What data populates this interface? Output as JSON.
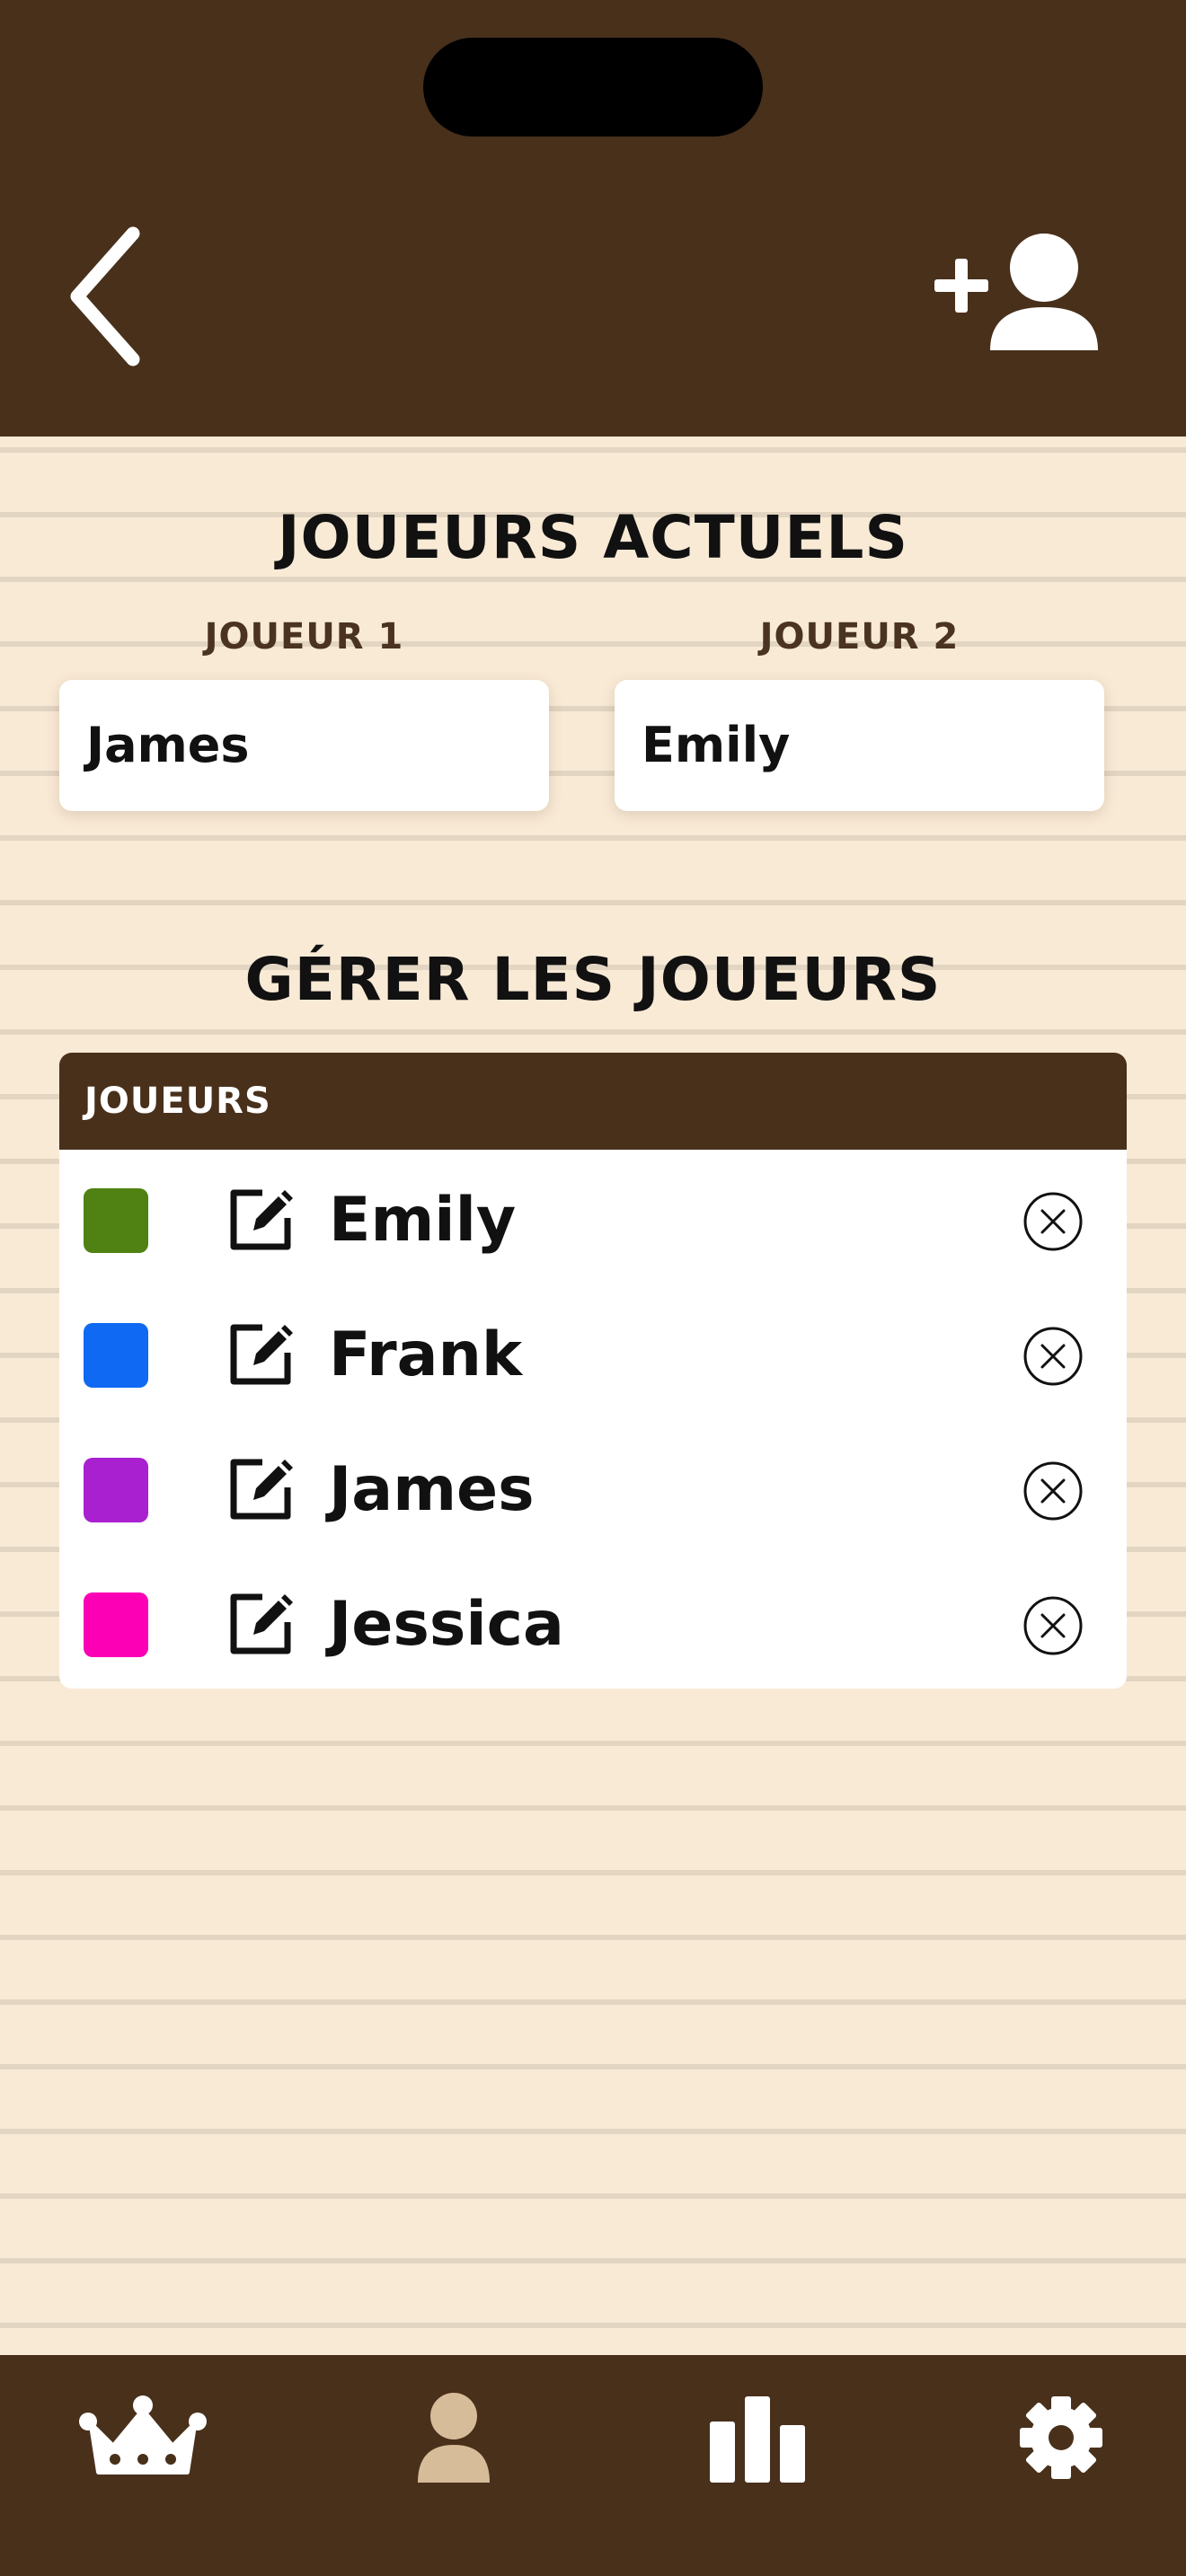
{
  "header": {
    "back_icon": "chevron-left-icon",
    "add_player_icon": "user-plus-icon"
  },
  "current_players": {
    "title": "JOUEURS ACTUELS",
    "player1_label": "JOUEUR 1",
    "player1_value": "James",
    "player2_label": "JOUEUR 2",
    "player2_value": "Emily"
  },
  "manage": {
    "title": "GÉRER LES JOUEURS",
    "table_header": "JOUEURS",
    "players": [
      {
        "name": "Emily",
        "color": "#4f8212"
      },
      {
        "name": "Frank",
        "color": "#0f69f2"
      },
      {
        "name": "James",
        "color": "#a920d0"
      },
      {
        "name": "Jessica",
        "color": "#fb00b5"
      }
    ],
    "edit_icon": "edit-icon",
    "delete_icon": "close-circle-icon"
  },
  "bottom_nav": [
    {
      "icon": "crown-icon",
      "active": false
    },
    {
      "icon": "person-icon",
      "active": true
    },
    {
      "icon": "bar-chart-icon",
      "active": false
    },
    {
      "icon": "gear-icon",
      "active": false
    }
  ],
  "colors": {
    "bar_brown": "#48301b",
    "background": "#f9ead6",
    "active_tab": "#d6bc98"
  }
}
